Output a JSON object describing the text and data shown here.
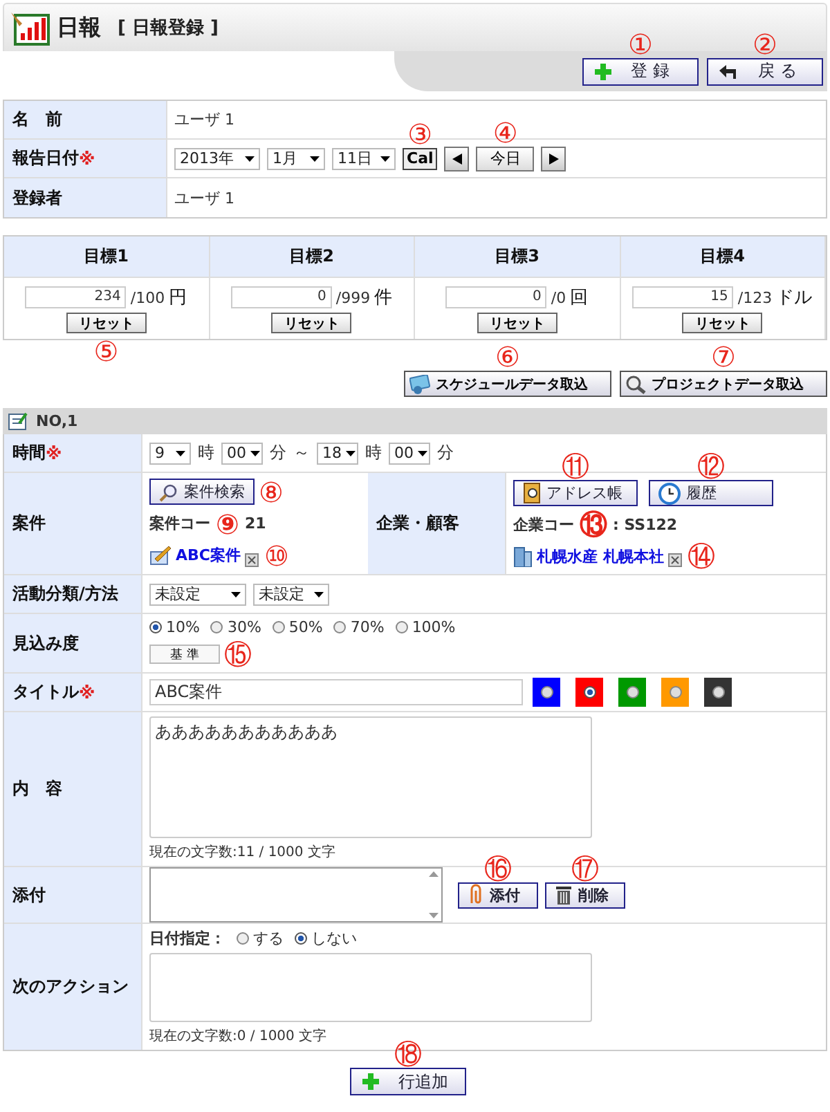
{
  "header": {
    "title": "日報",
    "subtitle": "[ 日報登録 ]"
  },
  "top_buttons": [
    {
      "kind": "register",
      "label": "登 録",
      "marker": "①"
    },
    {
      "kind": "back",
      "label": "戻 る",
      "marker": "②"
    }
  ],
  "info": {
    "name": {
      "label": "名　前",
      "value": "ユーザ 1"
    },
    "date": {
      "label": "報告日付",
      "required": "※",
      "year": "2013年",
      "month": "1月",
      "day": "11日",
      "cal": "Cal",
      "cal_marker": "③",
      "today": "今日",
      "today_marker": "④"
    },
    "registrant": {
      "label": "登録者",
      "value": "ユーザ 1"
    }
  },
  "goals": [
    {
      "label": "目標1",
      "value": "234",
      "target": "/100",
      "unit": "円",
      "reset": "リセット",
      "marker": "⑤"
    },
    {
      "label": "目標2",
      "value": "0",
      "target": "/999",
      "unit": "件",
      "reset": "リセット"
    },
    {
      "label": "目標3",
      "value": "0",
      "target": "/0",
      "unit": "回",
      "reset": "リセット"
    },
    {
      "label": "目標4",
      "value": "15",
      "target": "/123",
      "unit": "ドル",
      "reset": "リセット"
    }
  ],
  "imports": [
    {
      "kind": "schedule",
      "label": "スケジュールデータ取込",
      "marker": "⑥"
    },
    {
      "kind": "project",
      "label": "プロジェクトデータ取込",
      "marker": "⑦"
    }
  ],
  "record": {
    "number": "NO,1",
    "time": {
      "label": "時間",
      "required": "※",
      "start_hour": "9",
      "hour_unit": "時",
      "start_minute": "00",
      "minute_unit": "分",
      "separator": "～",
      "end_hour": "18",
      "end_hour_unit": "時",
      "end_minute": "00",
      "end_minute_unit": "分"
    },
    "case": {
      "label": "案件",
      "search": "案件検索",
      "search_marker": "⑧",
      "code_start": "案件コー",
      "code_marker": "⑨",
      "code_end": "21",
      "link": "ABC案件",
      "remove_marker": "⑩"
    },
    "company": {
      "label": "企業・顧客",
      "address_book": "アドレス帳",
      "address_marker": "⑪",
      "history": "履歴",
      "history_marker": "⑫",
      "code_start": "企業コー",
      "code_marker": "⑬",
      "code_end": ": SS122",
      "link": "札幌水産 札幌本社",
      "remove_marker": "⑭"
    },
    "activity": {
      "label": "活動分類/方法",
      "category": "未設定",
      "method": "未設定"
    },
    "probability": {
      "label": "見込み度",
      "options": [
        {
          "label": "10%",
          "selected": true
        },
        {
          "label": "30%",
          "selected": false
        },
        {
          "label": "50%",
          "selected": false
        },
        {
          "label": "70%",
          "selected": false
        },
        {
          "label": "100%",
          "selected": false
        }
      ],
      "standard": "基 準",
      "standard_marker": "⑮"
    },
    "title": {
      "label": "タイトル",
      "required": "※",
      "value": "ABC案件",
      "colors": [
        {
          "color": "#0000ff",
          "selected": false
        },
        {
          "color": "#ff0000",
          "selected": true
        },
        {
          "color": "#009900",
          "selected": false
        },
        {
          "color": "#ff9900",
          "selected": false
        },
        {
          "color": "#333333",
          "selected": false
        }
      ]
    },
    "content": {
      "label": "内　容",
      "value": "あああああああああああ",
      "counter": "現在の文字数:11 / 1000 文字"
    },
    "attachment": {
      "label": "添付",
      "attach": "添付",
      "attach_marker": "⑯",
      "delete": "削除",
      "delete_marker": "⑰"
    },
    "next_action": {
      "label": "次のアクション",
      "date_label": "日付指定：",
      "options": [
        {
          "label": "する",
          "selected": false
        },
        {
          "label": "しない",
          "selected": true
        }
      ],
      "counter": "現在の文字数:0 / 1000 文字"
    }
  },
  "add_row": {
    "label": "行追加",
    "marker": "⑱"
  }
}
